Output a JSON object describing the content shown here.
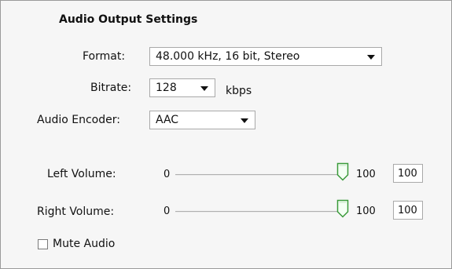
{
  "section": {
    "title": "Audio Output Settings"
  },
  "format": {
    "label": "Format:",
    "value": "48.000 kHz, 16 bit, Stereo"
  },
  "bitrate": {
    "label": "Bitrate:",
    "value": "128",
    "unit": "kbps"
  },
  "encoder": {
    "label": "Audio Encoder:",
    "value": "AAC"
  },
  "left_volume": {
    "label": "Left Volume:",
    "min": "0",
    "max": "100",
    "value": "100",
    "level": 1.0
  },
  "right_volume": {
    "label": "Right Volume:",
    "min": "0",
    "max": "100",
    "value": "100",
    "level": 1.0
  },
  "mute": {
    "label": "Mute Audio",
    "checked": false
  },
  "colors": {
    "thumb_accent": "#3a9a3a",
    "panel_bg": "#f6f6f6",
    "border": "#a9a9a9"
  }
}
